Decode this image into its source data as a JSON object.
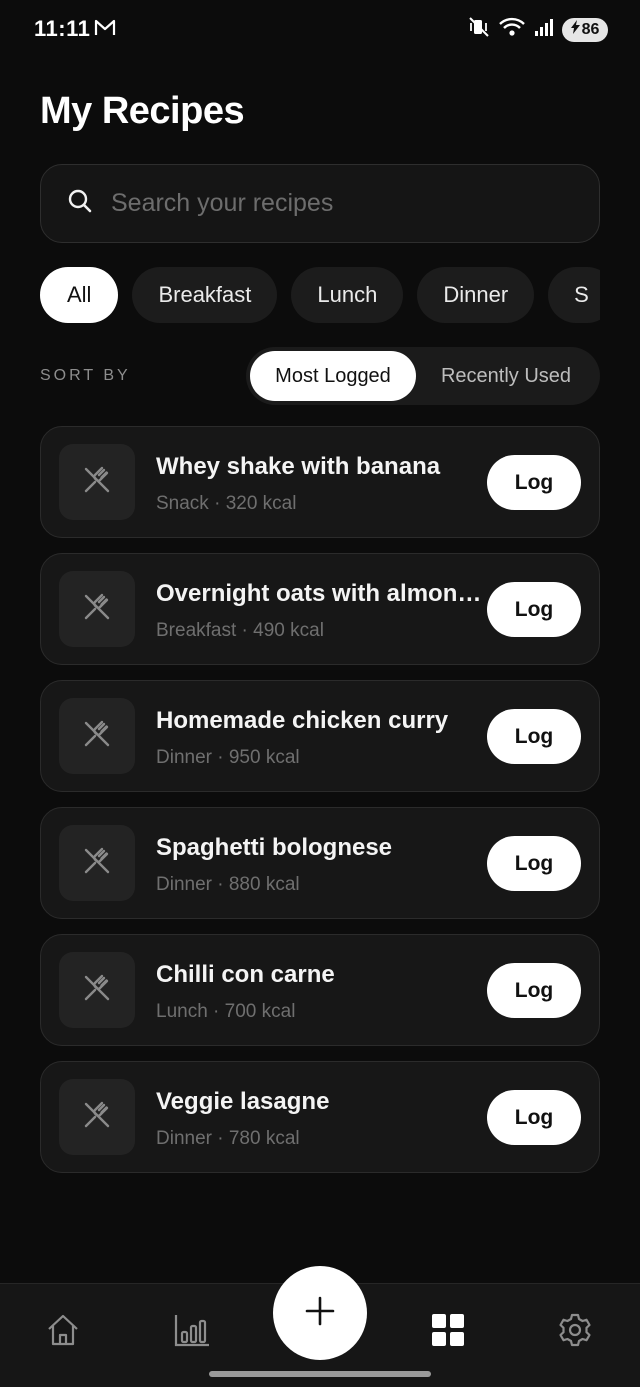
{
  "status_bar": {
    "time": "11:11",
    "battery": "86",
    "icons": [
      "gmail-icon",
      "vibrate-silent-icon",
      "wifi-icon",
      "signal-icon",
      "battery-charging-icon"
    ]
  },
  "header": {
    "title": "My Recipes"
  },
  "search": {
    "placeholder": "Search your recipes",
    "value": ""
  },
  "filters": {
    "items": [
      {
        "label": "All",
        "active": true
      },
      {
        "label": "Breakfast",
        "active": false
      },
      {
        "label": "Lunch",
        "active": false
      },
      {
        "label": "Dinner",
        "active": false
      },
      {
        "label": "S",
        "active": false
      }
    ]
  },
  "sort": {
    "label": "SORT BY",
    "options": [
      {
        "label": "Most Logged",
        "active": true
      },
      {
        "label": "Recently Used",
        "active": false
      }
    ]
  },
  "recipes": [
    {
      "name": "Whey shake with banana",
      "meta": "Snack · 320 kcal",
      "button": "Log"
    },
    {
      "name": "Overnight oats with almond milk",
      "meta": "Breakfast · 490 kcal",
      "button": "Log"
    },
    {
      "name": "Homemade chicken curry",
      "meta": "Dinner · 950 kcal",
      "button": "Log"
    },
    {
      "name": "Spaghetti bolognese",
      "meta": "Dinner · 880 kcal",
      "button": "Log"
    },
    {
      "name": "Chilli con carne",
      "meta": "Lunch · 700 kcal",
      "button": "Log"
    },
    {
      "name": "Veggie lasagne",
      "meta": "Dinner · 780 kcal",
      "button": "Log"
    }
  ],
  "bottom_nav": {
    "items": [
      "home-icon",
      "stats-icon",
      "add-icon",
      "grid-icon",
      "settings-icon"
    ],
    "active": "grid-icon"
  },
  "colors": {
    "background": "#0c0c0c",
    "card": "#171717",
    "accent": "#ffffff",
    "muted_text": "#6f6f6f"
  }
}
